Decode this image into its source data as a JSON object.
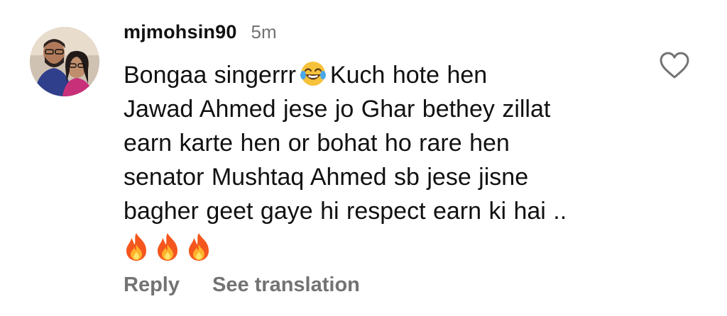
{
  "comment": {
    "username": "mjmohsin90",
    "timestamp": "5m",
    "text_part1": "Bongaa singerrr",
    "emoji_inline": "face-with-tears-of-joy-icon",
    "text_part2": "Kuch hote hen\nJawad Ahmed jese jo Ghar bethey zillat\nearn karte hen or bohat ho rare hen\nsenator Mushtaq Ahmed sb jese jisne\nbagher geet gaye hi respect earn ki hai ..",
    "trailing_emojis": [
      "fire-icon",
      "fire-icon",
      "fire-icon"
    ],
    "actions": {
      "reply_label": "Reply",
      "translate_label": "See translation"
    },
    "like_icon": "heart-outline-icon"
  },
  "colors": {
    "text": "#111111",
    "secondary": "#737373",
    "background": "#ffffff"
  }
}
